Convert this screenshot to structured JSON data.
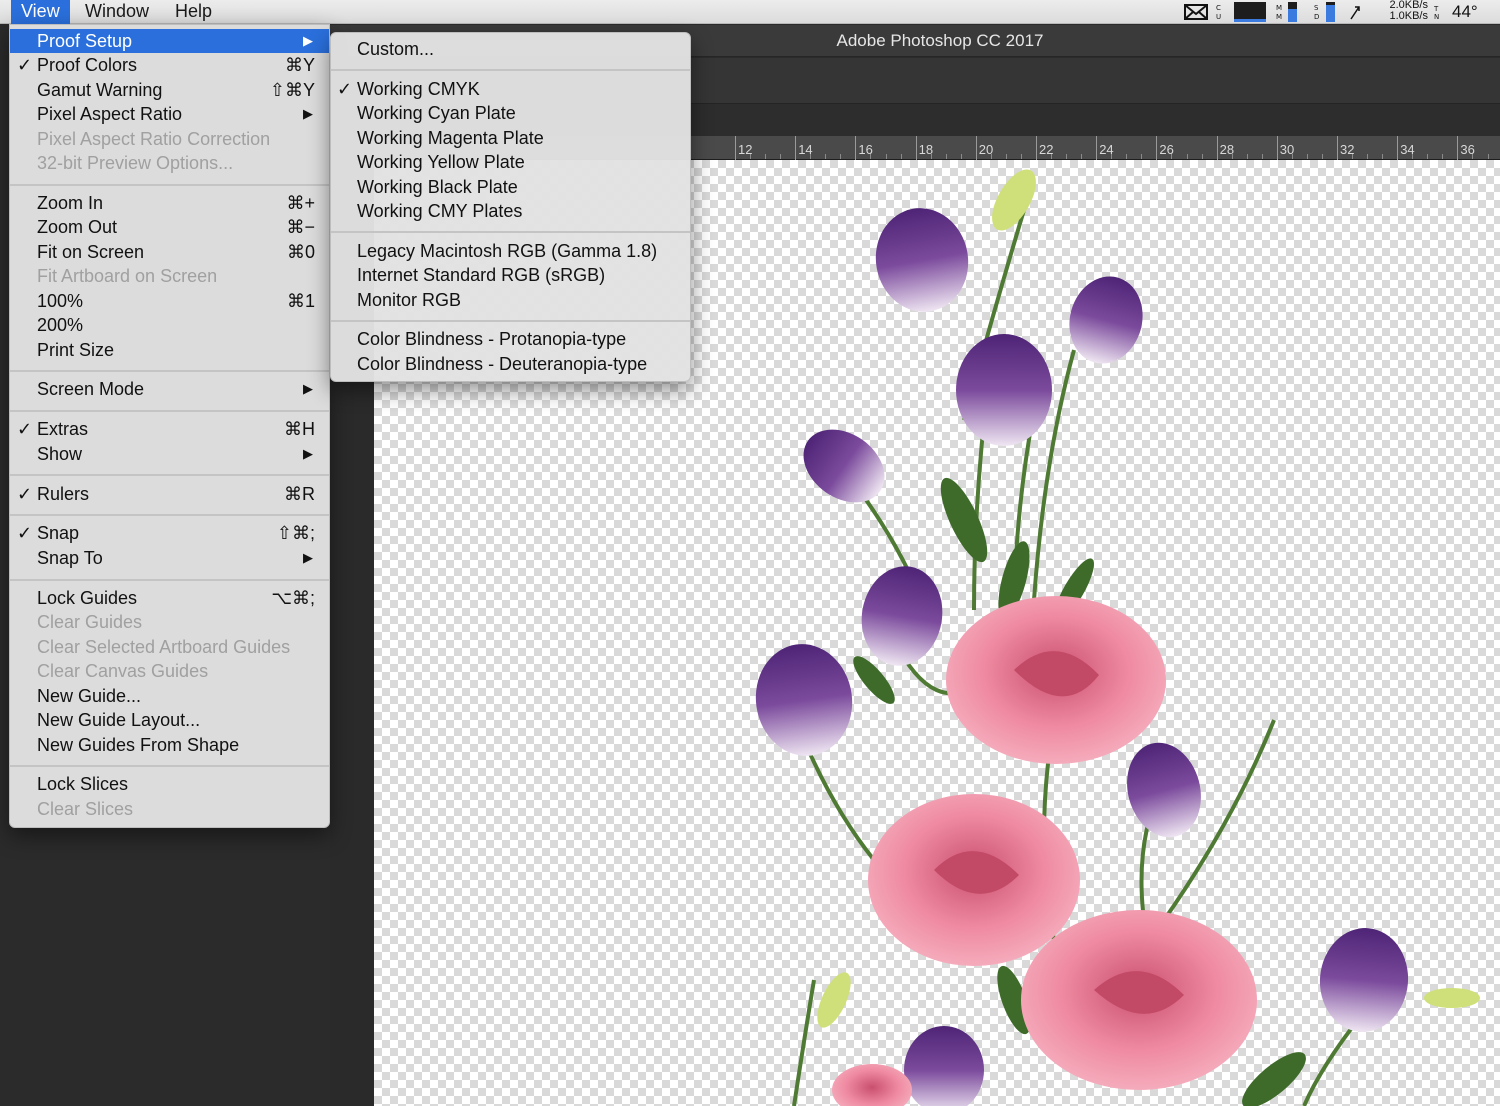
{
  "menubar": {
    "items": [
      {
        "label": "View"
      },
      {
        "label": "Window"
      },
      {
        "label": "Help"
      }
    ],
    "status": {
      "net_up": "2.0KB/s",
      "net_down": "1.0KB/s",
      "temp": "44°"
    }
  },
  "app": {
    "title": "Adobe Photoshop CC 2017",
    "ruler_labels": [
      "12",
      "14",
      "16",
      "18",
      "20",
      "22",
      "24",
      "26",
      "28",
      "30",
      "32",
      "34",
      "36"
    ]
  },
  "view_menu": {
    "items": [
      {
        "label": "Proof Setup",
        "shortcut": "",
        "submenu": true,
        "selected": true
      },
      {
        "label": "Proof Colors",
        "shortcut": "⌘Y",
        "checked": true
      },
      {
        "label": "Gamut Warning",
        "shortcut": "⇧⌘Y"
      },
      {
        "label": "Pixel Aspect Ratio",
        "submenu": true
      },
      {
        "label": "Pixel Aspect Ratio Correction",
        "disabled": true
      },
      {
        "label": "32-bit Preview Options...",
        "disabled": true
      },
      {
        "label": "Zoom In",
        "shortcut": "⌘+"
      },
      {
        "label": "Zoom Out",
        "shortcut": "⌘−"
      },
      {
        "label": "Fit on Screen",
        "shortcut": "⌘0"
      },
      {
        "label": "Fit Artboard on Screen",
        "disabled": true
      },
      {
        "label": "100%",
        "shortcut": "⌘1"
      },
      {
        "label": "200%"
      },
      {
        "label": "Print Size"
      },
      {
        "label": "Screen Mode",
        "submenu": true
      },
      {
        "label": "Extras",
        "shortcut": "⌘H",
        "checked": true
      },
      {
        "label": "Show",
        "submenu": true
      },
      {
        "label": "Rulers",
        "shortcut": "⌘R",
        "checked": true
      },
      {
        "label": "Snap",
        "shortcut": "⇧⌘;",
        "checked": true
      },
      {
        "label": "Snap To",
        "submenu": true
      },
      {
        "label": "Lock Guides",
        "shortcut": "⌥⌘;"
      },
      {
        "label": "Clear Guides",
        "disabled": true
      },
      {
        "label": "Clear Selected Artboard Guides",
        "disabled": true
      },
      {
        "label": "Clear Canvas Guides",
        "disabled": true
      },
      {
        "label": "New Guide..."
      },
      {
        "label": "New Guide Layout..."
      },
      {
        "label": "New Guides From Shape"
      },
      {
        "label": "Lock Slices"
      },
      {
        "label": "Clear Slices",
        "disabled": true
      }
    ]
  },
  "proof_setup_menu": {
    "items": [
      {
        "label": "Custom..."
      },
      {
        "label": "Working CMYK",
        "checked": true
      },
      {
        "label": "Working Cyan Plate"
      },
      {
        "label": "Working Magenta Plate"
      },
      {
        "label": "Working Yellow Plate"
      },
      {
        "label": "Working Black Plate"
      },
      {
        "label": "Working CMY Plates"
      },
      {
        "label": "Legacy Macintosh RGB (Gamma 1.8)"
      },
      {
        "label": "Internet Standard RGB (sRGB)"
      },
      {
        "label": "Monitor RGB"
      },
      {
        "label": "Color Blindness - Protanopia-type"
      },
      {
        "label": "Color Blindness - Deuteranopia-type"
      }
    ]
  },
  "glyphs": {
    "check": "✓",
    "arrow": "▶"
  }
}
